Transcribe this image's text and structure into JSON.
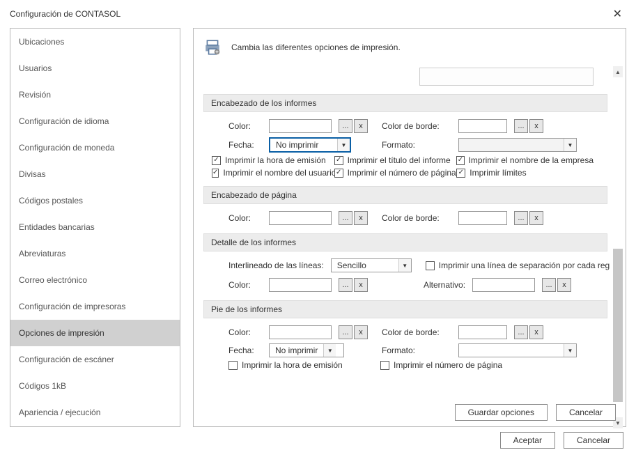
{
  "window": {
    "title": "Configuración de CONTASOL"
  },
  "sidebar": {
    "items": [
      "Ubicaciones",
      "Usuarios",
      "Revisión",
      "Configuración de idioma",
      "Configuración de moneda",
      "Divisas",
      "Códigos postales",
      "Entidades bancarias",
      "Abreviaturas",
      "Correo electrónico",
      "Configuración de impresoras",
      "Opciones de impresión",
      "Configuración de escáner",
      "Códigos 1kB",
      "Apariencia / ejecución"
    ],
    "selected_index": 11
  },
  "main": {
    "heading": "Cambia las diferentes opciones de impresión.",
    "groups": {
      "reportHeader": {
        "title": "Encabezado de los informes",
        "color_label": "Color:",
        "border_label": "Color de borde:",
        "date_label": "Fecha:",
        "date_value": "No imprimir",
        "format_label": "Formato:",
        "checks": [
          {
            "label": "Imprimir la hora de emisión",
            "checked": true
          },
          {
            "label": "Imprimir el título del informe",
            "checked": true
          },
          {
            "label": "Imprimir el nombre de la empresa",
            "checked": true
          },
          {
            "label": "Imprimir el nombre del usuario",
            "checked": true
          },
          {
            "label": "Imprimir el número de página",
            "checked": true
          },
          {
            "label": "Imprimir límites",
            "checked": true
          }
        ]
      },
      "pageHeader": {
        "title": "Encabezado de página",
        "color_label": "Color:",
        "border_label": "Color de borde:"
      },
      "detail": {
        "title": "Detalle de los informes",
        "interline_label": "Interlineado de las líneas:",
        "interline_value": "Sencillo",
        "separator_check": "Imprimir una línea de separación por cada registro",
        "color_label": "Color:",
        "alt_label": "Alternativo:"
      },
      "footer": {
        "title": "Pie de los informes",
        "color_label": "Color:",
        "border_label": "Color de borde:",
        "date_label": "Fecha:",
        "date_value": "No imprimir",
        "format_label": "Formato:",
        "checks": [
          {
            "label": "Imprimir la hora de emisión",
            "checked": false
          },
          {
            "label": "Imprimir el número de página",
            "checked": false
          }
        ]
      }
    },
    "buttons": {
      "save": "Guardar opciones",
      "cancel": "Cancelar"
    }
  },
  "dialog_buttons": {
    "ok": "Aceptar",
    "cancel": "Cancelar"
  }
}
